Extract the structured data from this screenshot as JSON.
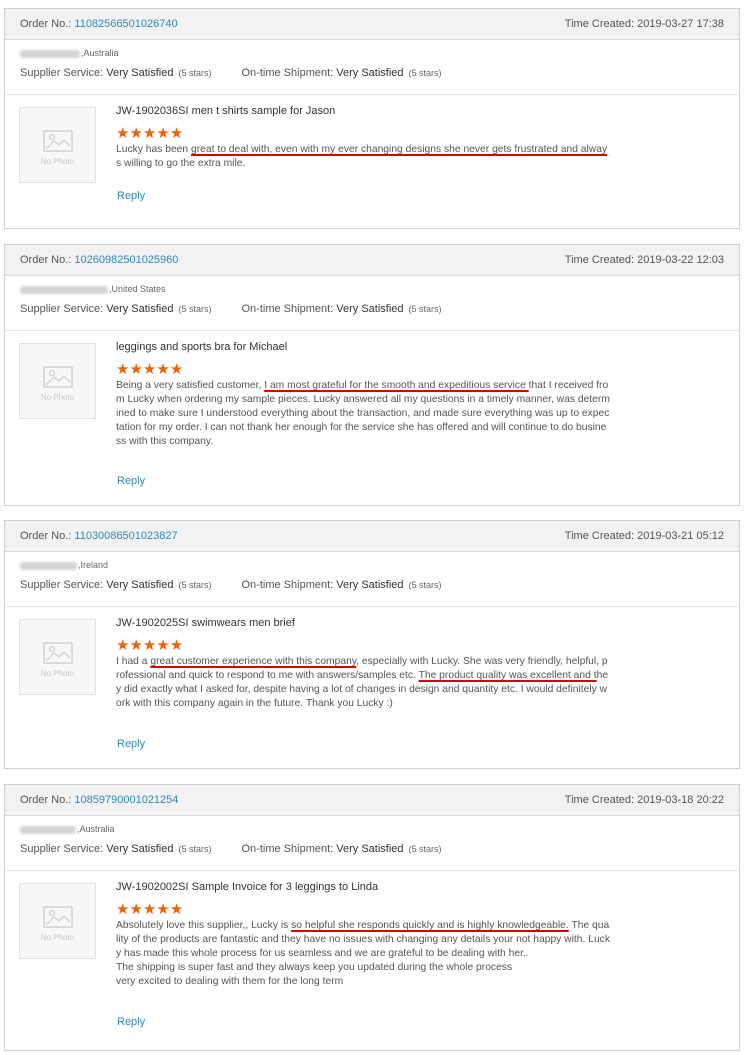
{
  "labels": {
    "order_no": "Order No.: ",
    "time_created": "Time Created: ",
    "supplier_service": "Supplier Service:",
    "ontime_shipment": "On-time Shipment:",
    "no_photo": "No Photo",
    "reply": "Reply"
  },
  "colors": {
    "link": "#2a8ac6",
    "stars": "#f0620a",
    "underline": "#d80000"
  },
  "reviews": [
    {
      "order_no": "11082566501026740",
      "time": "2019-03-27 17:38",
      "country": "Australia",
      "supplier_value": "Very Satisfied",
      "supplier_stars": "(5 stars)",
      "shipment_value": "Very Satisfied",
      "shipment_stars": "(5 stars)",
      "product_title": "JW-1902036SI men t shirts sample for Jason",
      "rating_stars": 5,
      "comment": [
        {
          "t": "Lucky has been ",
          "u": false
        },
        {
          "t": "great to deal with, even with my ever changing designs she never gets frustrated and alway",
          "u": true
        },
        {
          "t": "s willing to go the extra mile.",
          "u": false
        }
      ]
    },
    {
      "order_no": "10260982501025960",
      "time": "2019-03-22 12:03",
      "country": "United States",
      "supplier_value": "Very Satisfied",
      "supplier_stars": "(5 stars)",
      "shipment_value": "Very Satisfied",
      "shipment_stars": "(5 stars)",
      "product_title": "leggings and sports bra for Michael",
      "rating_stars": 5,
      "comment": [
        {
          "t": "Being a very satisfied customer, ",
          "u": false
        },
        {
          "t": "I am most grateful for the smooth and expeditious service ",
          "u": true
        },
        {
          "t": "that I received from Lucky when ordering my sample pieces. Lucky answered all my questions in a timely manner, was determined to make sure I understood everything about the transaction, and made sure everything was up to expectation for my order. I can not thank her enough for the service she has offered and will continue to do business with this company.",
          "u": false
        }
      ]
    },
    {
      "order_no": "11030086501023827",
      "time": "2019-03-21 05:12",
      "country": "Ireland",
      "supplier_value": "Very Satisfied",
      "supplier_stars": "(5 stars)",
      "shipment_value": "Very Satisfied",
      "shipment_stars": "(5 stars)",
      "product_title": "JW-1902025SI swimwears men brief",
      "rating_stars": 5,
      "comment": [
        {
          "t": "I had a ",
          "u": false
        },
        {
          "t": "great customer experience with this company",
          "u": true
        },
        {
          "t": ", especially with Lucky. She was very friendly, helpful, professional and quick to respond to me with answers/samples etc. ",
          "u": false
        },
        {
          "t": "The product quality was excellent and t",
          "u": true
        },
        {
          "t": "hey did exactly what I asked for, despite having a lot of changes in design and quantity etc. I would definitely work with this company again in the future. Thank you Lucky :)",
          "u": false
        }
      ]
    },
    {
      "order_no": "10859790001021254",
      "time": "2019-03-18 20:22",
      "country": "Australia",
      "supplier_value": "Very Satisfied",
      "supplier_stars": "(5 stars)",
      "shipment_value": "Very Satisfied",
      "shipment_stars": "(5 stars)",
      "product_title": "JW-1902002SI Sample Invoice for 3 leggings to Linda",
      "rating_stars": 5,
      "comment": [
        {
          "t": "Absolutely love this supplier,, Lucky is ",
          "u": false
        },
        {
          "t": "so helpful she responds quickly and is highly knowledgeable.",
          "u": true
        },
        {
          "t": " The quality of the products are fantastic and they have no issues with changing any details your not happy with. Lucky has made this whole process for us seamless and we are grateful to be dealing with her..",
          "u": false
        },
        {
          "t": "\n",
          "u": false
        },
        {
          "t": "The shipping is super fast and they always keep you updated during the whole process",
          "u": false
        },
        {
          "t": "\n",
          "u": false
        },
        {
          "t": "very excited to dealing with them for the long term",
          "u": false
        }
      ]
    }
  ]
}
